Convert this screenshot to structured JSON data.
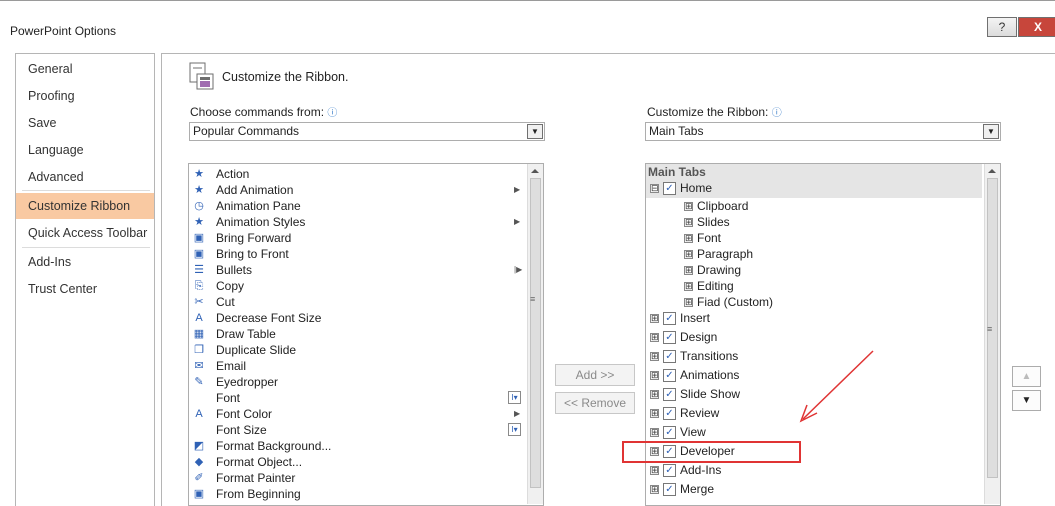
{
  "window": {
    "title": "PowerPoint Options",
    "help": "?",
    "close": "X"
  },
  "nav": {
    "items": [
      "General",
      "Proofing",
      "Save",
      "Language",
      "Advanced",
      "Customize Ribbon",
      "Quick Access Toolbar",
      "Add-Ins",
      "Trust Center"
    ],
    "selected": "Customize Ribbon"
  },
  "header": {
    "title": "Customize the Ribbon."
  },
  "left_pane": {
    "label": "Choose commands from:",
    "info": "ⓘ",
    "selected": "Popular Commands",
    "commands": [
      {
        "label": "Action",
        "icon": "action-icon",
        "glyph": "★"
      },
      {
        "label": "Add Animation",
        "icon": "add-animation-icon",
        "glyph": "★",
        "sub": "▶"
      },
      {
        "label": "Animation Pane",
        "icon": "animation-pane-icon",
        "glyph": "◷"
      },
      {
        "label": "Animation Styles",
        "icon": "animation-styles-icon",
        "glyph": "★",
        "sub": "▶"
      },
      {
        "label": "Bring Forward",
        "icon": "bring-forward-icon",
        "glyph": "▣"
      },
      {
        "label": "Bring to Front",
        "icon": "bring-to-front-icon",
        "glyph": "▣"
      },
      {
        "label": "Bullets",
        "icon": "bullets-icon",
        "glyph": "☰",
        "sub": "|▶"
      },
      {
        "label": "Copy",
        "icon": "copy-icon",
        "glyph": "⎘"
      },
      {
        "label": "Cut",
        "icon": "cut-icon",
        "glyph": "✂"
      },
      {
        "label": "Decrease Font Size",
        "icon": "decrease-font-icon",
        "glyph": "A"
      },
      {
        "label": "Draw Table",
        "icon": "draw-table-icon",
        "glyph": "▦"
      },
      {
        "label": "Duplicate Slide",
        "icon": "duplicate-slide-icon",
        "glyph": "❐"
      },
      {
        "label": "Email",
        "icon": "email-icon",
        "glyph": "✉"
      },
      {
        "label": "Eyedropper",
        "icon": "eyedropper-icon",
        "glyph": "✎"
      },
      {
        "label": "Font",
        "icon": "font-icon",
        "glyph": "",
        "box": "I▾"
      },
      {
        "label": "Font Color",
        "icon": "font-color-icon",
        "glyph": "A",
        "sub": "▶"
      },
      {
        "label": "Font Size",
        "icon": "font-size-icon",
        "glyph": "",
        "box": "I▾"
      },
      {
        "label": "Format Background...",
        "icon": "format-background-icon",
        "glyph": "◩"
      },
      {
        "label": "Format Object...",
        "icon": "format-object-icon",
        "glyph": "◆"
      },
      {
        "label": "Format Painter",
        "icon": "format-painter-icon",
        "glyph": "✐"
      },
      {
        "label": "From Beginning",
        "icon": "from-beginning-icon",
        "glyph": "▣"
      }
    ]
  },
  "right_pane": {
    "label": "Customize the Ribbon:",
    "info": "ⓘ",
    "selected": "Main Tabs",
    "tree_header": "Main Tabs",
    "home": "Home",
    "home_groups": [
      "Clipboard",
      "Slides",
      "Font",
      "Paragraph",
      "Drawing",
      "Editing",
      "Fiad (Custom)"
    ],
    "tabs": [
      "Insert",
      "Design",
      "Transitions",
      "Animations",
      "Slide Show",
      "Review",
      "View",
      "Developer",
      "Add-Ins",
      "Merge"
    ]
  },
  "buttons": {
    "add": "Add >>",
    "remove": "<< Remove"
  },
  "glyphs": {
    "expand": "⊞",
    "collapse": "⊟",
    "check": "✓",
    "dropdown": "▼",
    "up": "▲",
    "down": "▼",
    "grip": "≡"
  },
  "annotation": {
    "color": "#e03434"
  }
}
